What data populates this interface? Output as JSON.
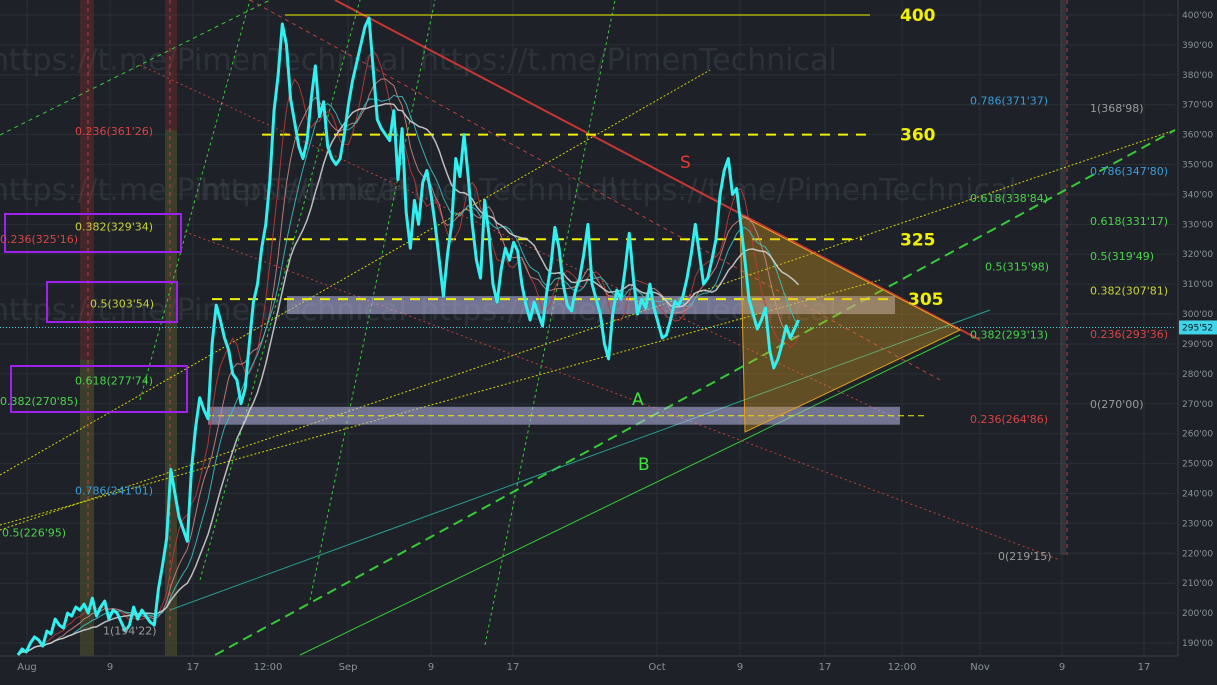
{
  "watermark": "https://t.me/PimenTechnical",
  "colors": {
    "background": "#1e2228",
    "grid": "#2a2f36",
    "price": "#30f0f0",
    "resistance": "#e53935",
    "support": "#39e639",
    "levels": "#f0f000",
    "fib_red": "#d84343",
    "fib_green": "#4bd14b",
    "fib_blue": "#3a9bd6",
    "fib_gray": "#9a9a9a",
    "fib_teal": "#2bb3a0",
    "fib_yellow": "#c8d23a",
    "purple_box": "#a020f0",
    "zone_fill": "#b8b8e8",
    "triangle_fill": "#e0a020",
    "current_price_tag": "#3fd4e8"
  },
  "chart_data": {
    "type": "line",
    "y_axis": {
      "ylim": [
        185,
        404
      ],
      "ticks": [
        "190'00",
        "200'00",
        "210'00",
        "220'00",
        "230'00",
        "240'00",
        "250'00",
        "260'00",
        "270'00",
        "280'00",
        "290'00",
        "300'00",
        "310'00",
        "320'00",
        "330'00",
        "340'00",
        "350'00",
        "360'00",
        "370'00",
        "380'00",
        "390'00",
        "400'00"
      ],
      "current_price": "295'52"
    },
    "x_axis": {
      "ticks": [
        "Aug",
        "9",
        "17",
        "12:00",
        "Sep",
        "9",
        "17",
        "Oct",
        "9",
        "17",
        "12:00",
        "Nov",
        "9",
        "17"
      ]
    },
    "series": [
      {
        "x": [
          1,
          2,
          3,
          4,
          5,
          6,
          7,
          8,
          9,
          10,
          11,
          12,
          13,
          14,
          15,
          16,
          17,
          18,
          19,
          20,
          21,
          22,
          23,
          24,
          25,
          26,
          27,
          28,
          29,
          30,
          31,
          32,
          33,
          34,
          35,
          36,
          37,
          38,
          39,
          40,
          41,
          42,
          43,
          44,
          45,
          46,
          47,
          48,
          49,
          50,
          51,
          52,
          53,
          54,
          55,
          56,
          57,
          58,
          59,
          60,
          61,
          62,
          63,
          64,
          65,
          66,
          67,
          68,
          69,
          70,
          71,
          72,
          73,
          74,
          75,
          76,
          77,
          78,
          79,
          80,
          81,
          82,
          83,
          84,
          85,
          86,
          87,
          88,
          89,
          90,
          91,
          92,
          93,
          94,
          95,
          96,
          97,
          98,
          99,
          100,
          101,
          102,
          103,
          104,
          105,
          106,
          107,
          108,
          109,
          110,
          111,
          112,
          113,
          114,
          115,
          116,
          117,
          118,
          119,
          120,
          121,
          122,
          123,
          124,
          125,
          126,
          127,
          128,
          129,
          130,
          131,
          132,
          133,
          134,
          135,
          136,
          137,
          138,
          139,
          140,
          141,
          142,
          143,
          144,
          145,
          146,
          147,
          148,
          149,
          150,
          151,
          152,
          153,
          154,
          155,
          156,
          157,
          158,
          159,
          160,
          161,
          162,
          163,
          164,
          165,
          166,
          167,
          168,
          169,
          170,
          171,
          172,
          173,
          174,
          175,
          176,
          177,
          178,
          179,
          180,
          181,
          182,
          183,
          184,
          185,
          186,
          187,
          188,
          189,
          190
        ],
        "values": [
          186,
          188,
          187,
          190,
          192,
          191,
          189,
          194,
          193,
          198,
          196,
          195,
          200,
          199,
          202,
          201,
          203,
          200,
          205,
          199,
          202,
          204,
          198,
          201,
          200,
          197,
          194,
          196,
          202,
          198,
          201,
          199,
          197,
          196,
          208,
          216,
          225,
          248,
          240,
          232,
          228,
          224,
          248,
          262,
          272,
          268,
          265,
          290,
          303,
          298,
          292,
          288,
          280,
          278,
          270,
          275,
          290,
          304,
          310,
          322,
          330,
          345,
          368,
          380,
          397,
          390,
          372,
          364,
          356,
          352,
          358,
          372,
          383,
          366,
          371,
          356,
          352,
          350,
          352,
          360,
          370,
          378,
          384,
          390,
          396,
          399,
          382,
          365,
          362,
          360,
          358,
          368,
          345,
          362,
          334,
          322,
          338,
          330,
          344,
          348,
          340,
          330,
          318,
          306,
          320,
          330,
          352,
          346,
          360,
          346,
          330,
          318,
          312,
          338,
          327,
          310,
          304,
          315,
          322,
          318,
          324,
          321,
          310,
          303,
          298,
          304,
          300,
          296,
          307,
          316,
          329,
          322,
          310,
          303,
          301,
          308,
          312,
          320,
          330,
          310,
          305,
          300,
          290,
          285,
          300,
          308,
          305,
          315,
          327,
          312,
          300,
          305,
          302,
          310,
          302,
          297,
          292,
          293,
          298,
          304,
          303,
          306,
          312,
          320,
          330,
          320,
          310,
          312,
          318,
          325,
          340,
          348,
          352,
          340,
          342,
          330,
          318,
          305,
          300,
          295,
          298,
          302,
          288,
          282,
          285,
          290,
          296,
          292,
          295,
          298
        ],
        "note_ignore": ""
      }
    ],
    "levels": [
      {
        "label": "400",
        "value": 400
      },
      {
        "label": "360",
        "value": 360
      },
      {
        "label": "325",
        "value": 325
      },
      {
        "label": "305",
        "value": 305
      }
    ],
    "pattern_labels": [
      "S",
      "A",
      "B"
    ],
    "fib_labels_left": [
      {
        "text": "0.236(361'26)",
        "value": 361.26
      },
      {
        "text": "0.382(329'34)",
        "value": 329.34
      },
      {
        "text": "0.236(325'16)",
        "value": 325.16
      },
      {
        "text": "0.5(303'54)",
        "value": 303.54
      },
      {
        "text": "0.618(277'74)",
        "value": 277.74
      },
      {
        "text": "0.382(270'85)",
        "value": 270.85
      },
      {
        "text": "0.786(241'01)",
        "value": 241.01
      },
      {
        "text": "0.5(226'95)",
        "value": 226.95
      },
      {
        "text": "1(194'22)",
        "value": 194.22
      }
    ],
    "fib_labels_right": [
      {
        "text": "0.786(371'37)",
        "value": 371.37
      },
      {
        "text": "1(368'98)",
        "value": 368.98
      },
      {
        "text": "0.786(347'80)",
        "value": 347.8
      },
      {
        "text": "0.618(338'84)",
        "value": 338.84
      },
      {
        "text": "0.618(331'17)",
        "value": 331.17
      },
      {
        "text": "0.5(319'49)",
        "value": 319.49
      },
      {
        "text": "0.5(315'98)",
        "value": 315.98
      },
      {
        "text": "0.382(307'81)",
        "value": 307.81
      },
      {
        "text": "0.382(293'13)",
        "value": 293.13
      },
      {
        "text": "0.236(293'36)",
        "value": 293.36
      },
      {
        "text": "0(270'00)",
        "value": 270
      },
      {
        "text": "0.236(264'86)",
        "value": 264.86
      },
      {
        "text": "0(219'15)",
        "value": 219.15
      }
    ],
    "zones": [
      {
        "from": 300,
        "to": 306
      },
      {
        "from": 263,
        "to": 269
      }
    ]
  }
}
